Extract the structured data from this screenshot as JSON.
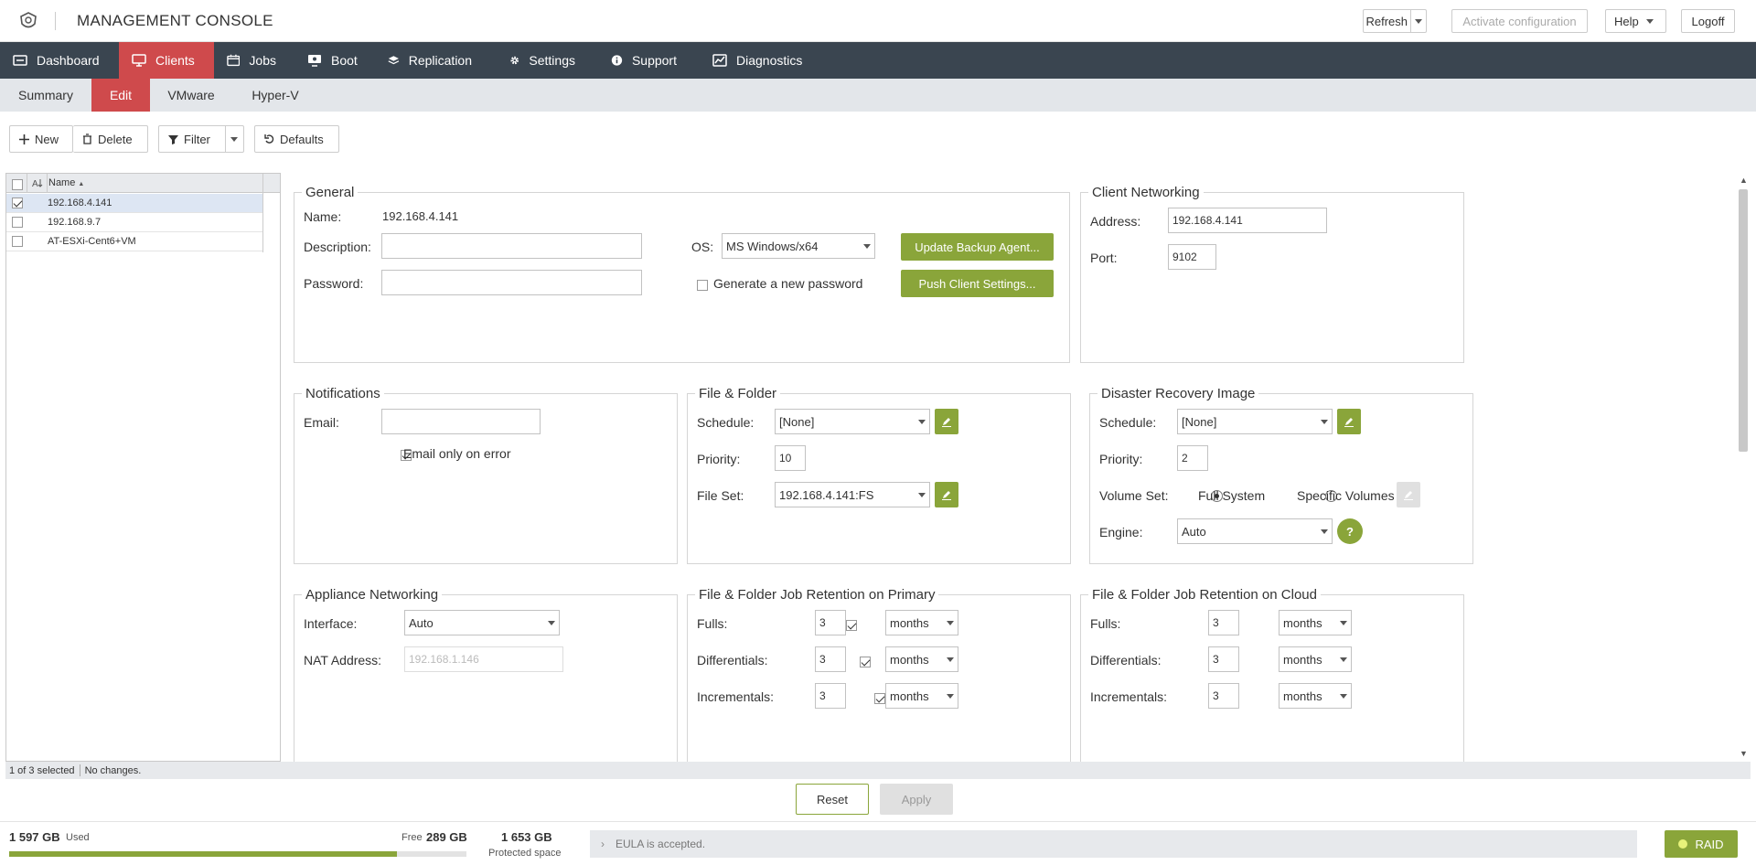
{
  "header": {
    "title": "MANAGEMENT CONSOLE",
    "refresh": "Refresh",
    "activate": "Activate configuration",
    "help": "Help",
    "logoff": "Logoff"
  },
  "nav": [
    "Dashboard",
    "Clients",
    "Jobs",
    "Boot",
    "Replication",
    "Settings",
    "Support",
    "Diagnostics"
  ],
  "subnav": [
    "Summary",
    "Edit",
    "VMware",
    "Hyper-V"
  ],
  "toolbar": {
    "new": "New",
    "delete": "Delete",
    "filter": "Filter",
    "defaults": "Defaults"
  },
  "client_list": {
    "column": "Name",
    "rows": [
      {
        "name": "192.168.4.141",
        "checked": true
      },
      {
        "name": "192.168.9.7",
        "checked": false
      },
      {
        "name": "AT-ESXi-Cent6+VM",
        "checked": false
      }
    ],
    "selection_status": "1 of 3 selected",
    "change_status": "No changes."
  },
  "general": {
    "legend": "General",
    "name_label": "Name:",
    "name_value": "192.168.4.141",
    "description_label": "Description:",
    "description_value": "",
    "password_label": "Password:",
    "password_value": "",
    "os_label": "OS:",
    "os_value": "MS Windows/x64",
    "generate_password_label": "Generate a new password",
    "update_agent": "Update Backup Agent...",
    "push_settings": "Push Client Settings..."
  },
  "client_networking": {
    "legend": "Client Networking",
    "address_label": "Address:",
    "address_value": "192.168.4.141",
    "port_label": "Port:",
    "port_value": "9102"
  },
  "notifications": {
    "legend": "Notifications",
    "email_label": "Email:",
    "email_value": "",
    "email_on_error_label": "Email only on error",
    "email_on_error": true
  },
  "file_folder": {
    "legend": "File & Folder",
    "schedule_label": "Schedule:",
    "schedule_value": "[None]",
    "priority_label": "Priority:",
    "priority_value": "10",
    "fileset_label": "File Set:",
    "fileset_value": "192.168.4.141:FS"
  },
  "dr_image": {
    "legend": "Disaster Recovery Image",
    "schedule_label": "Schedule:",
    "schedule_value": "[None]",
    "priority_label": "Priority:",
    "priority_value": "2",
    "volume_label": "Volume Set:",
    "full_system": "Full System",
    "specific_volumes": "Specific Volumes",
    "engine_label": "Engine:",
    "engine_value": "Auto",
    "help_glyph": "?"
  },
  "appliance_networking": {
    "legend": "Appliance Networking",
    "interface_label": "Interface:",
    "interface_value": "Auto",
    "nat_label": "NAT Address:",
    "nat_placeholder": "192.168.1.146"
  },
  "retention_primary": {
    "legend": "File & Folder Job Retention on Primary",
    "rows": [
      {
        "label": "Fulls:",
        "checked": true,
        "value": "3",
        "unit": "months"
      },
      {
        "label": "Differentials:",
        "checked": true,
        "value": "3",
        "unit": "months"
      },
      {
        "label": "Incrementals:",
        "checked": true,
        "value": "3",
        "unit": "months"
      }
    ]
  },
  "retention_cloud": {
    "legend": "File & Folder Job Retention on Cloud",
    "rows": [
      {
        "label": "Fulls:",
        "checked": true,
        "value": "3",
        "unit": "months"
      },
      {
        "label": "Differentials:",
        "checked": true,
        "value": "3",
        "unit": "months"
      },
      {
        "label": "Incrementals:",
        "checked": true,
        "value": "3",
        "unit": "months"
      }
    ]
  },
  "actions": {
    "reset": "Reset",
    "apply": "Apply"
  },
  "footer": {
    "used_value": "1 597 GB",
    "used_label": "Used",
    "free_label": "Free",
    "free_value": "289 GB",
    "used_fraction": 0.847,
    "protected_value": "1 653 GB",
    "protected_label": "Protected space",
    "eula": "EULA is accepted.",
    "raid": "RAID"
  },
  "colors": {
    "accent_red": "#cf4a4c",
    "nav_bg": "#3a4550",
    "green": "#8aa53a"
  }
}
